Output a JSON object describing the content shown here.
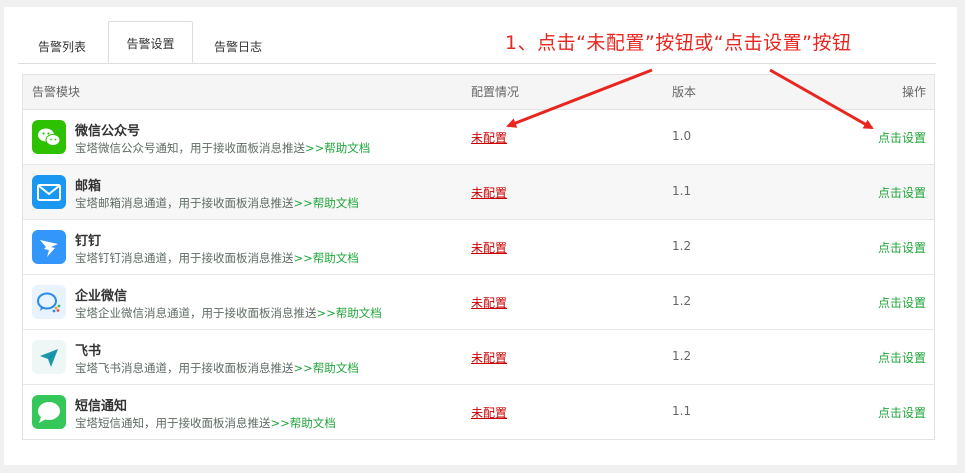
{
  "tabs": [
    {
      "label": "告警列表",
      "active": false
    },
    {
      "label": "告警设置",
      "active": true
    },
    {
      "label": "告警日志",
      "active": false
    }
  ],
  "annotation": "1、点击“未配置”按钮或“点击设置”按钮",
  "table": {
    "headers": [
      "告警模块",
      "配置情况",
      "版本",
      "操作"
    ],
    "rows": [
      {
        "name": "微信公众号",
        "desc": "宝塔微信公众号通知，用于接收面板消息推送",
        "help": ">>帮助文档",
        "status": "未配置",
        "version": "1.0",
        "action": "点击设置",
        "icon": "wechat-icon",
        "icon_color": "#2dc100"
      },
      {
        "name": "邮箱",
        "desc": "宝塔邮箱消息通道，用于接收面板消息推送",
        "help": ">>帮助文档",
        "status": "未配置",
        "version": "1.1",
        "action": "点击设置",
        "icon": "mail-icon",
        "icon_color": "#1a97f0"
      },
      {
        "name": "钉钉",
        "desc": "宝塔钉钉消息通道，用于接收面板消息推送",
        "help": ">>帮助文档",
        "status": "未配置",
        "version": "1.2",
        "action": "点击设置",
        "icon": "dingtalk-icon",
        "icon_color": "#3296fa"
      },
      {
        "name": "企业微信",
        "desc": "宝塔企业微信消息通道，用于接收面板消息推送",
        "help": ">>帮助文档",
        "status": "未配置",
        "version": "1.2",
        "action": "点击设置",
        "icon": "wecom-icon",
        "icon_color": "#e8f3fd"
      },
      {
        "name": "飞书",
        "desc": "宝塔飞书消息通道，用于接收面板消息推送",
        "help": ">>帮助文档",
        "status": "未配置",
        "version": "1.2",
        "action": "点击设置",
        "icon": "feishu-icon",
        "icon_color": "#eef7f6"
      },
      {
        "name": "短信通知",
        "desc": "宝塔短信通知，用于接收面板消息推送",
        "help": ">>帮助文档",
        "status": "未配置",
        "version": "1.1",
        "action": "点击设置",
        "icon": "sms-icon",
        "icon_color": "#35c759"
      }
    ]
  },
  "colors": {
    "accent_green": "#20a53a",
    "status_red": "#c80000",
    "annotation_red": "#e8261f"
  }
}
